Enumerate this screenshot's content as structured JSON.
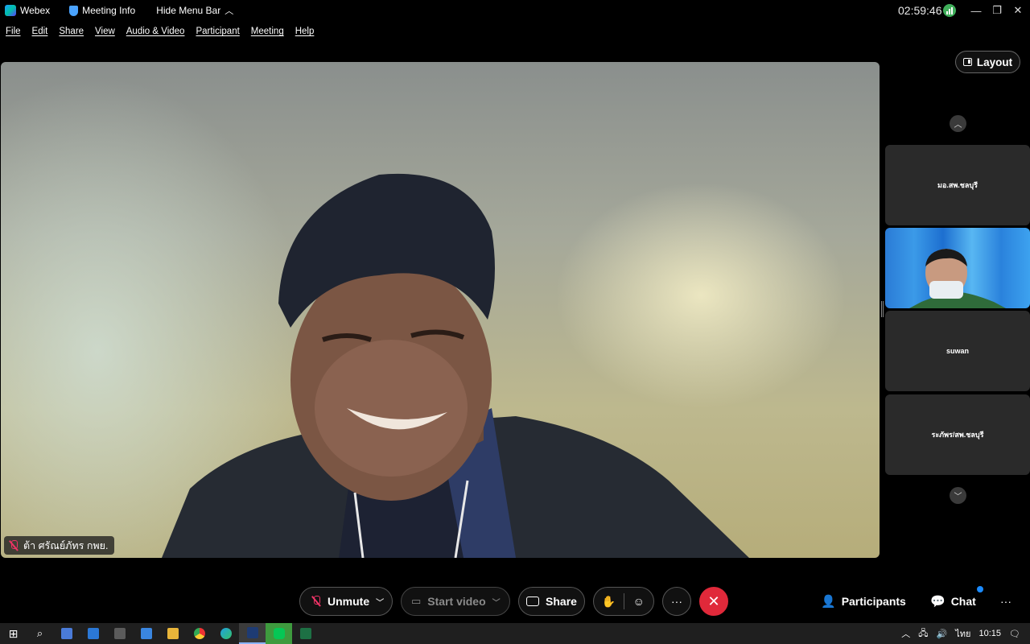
{
  "titlebar": {
    "app_name": "Webex",
    "meeting_info": "Meeting Info",
    "hide_menu": "Hide Menu Bar",
    "clock": "02:59:46"
  },
  "menu": [
    "File",
    "Edit",
    "Share",
    "View",
    "Audio & Video",
    "Participant",
    "Meeting",
    "Help"
  ],
  "main_video": {
    "name": "ต้า ศรัณย์ภัทร กพย."
  },
  "sidebar": {
    "layout_label": "Layout",
    "tiles": [
      {
        "name": "มอ.สพ.ชลบุรี"
      },
      {
        "name": ""
      },
      {
        "name": "suwan"
      },
      {
        "name": "ระภัพร/สพ.ชลบุรี"
      }
    ]
  },
  "controls": {
    "unmute": "Unmute",
    "start_video": "Start video",
    "share": "Share",
    "more": "···",
    "participants": "Participants",
    "chat": "Chat",
    "overflow": "···"
  },
  "taskbar": {
    "lang": "ไทย",
    "time": "10:15"
  },
  "colors": {
    "end_button": "#e0293a",
    "connection_good": "#3fae5a",
    "chat_badge": "#1b8bff"
  }
}
